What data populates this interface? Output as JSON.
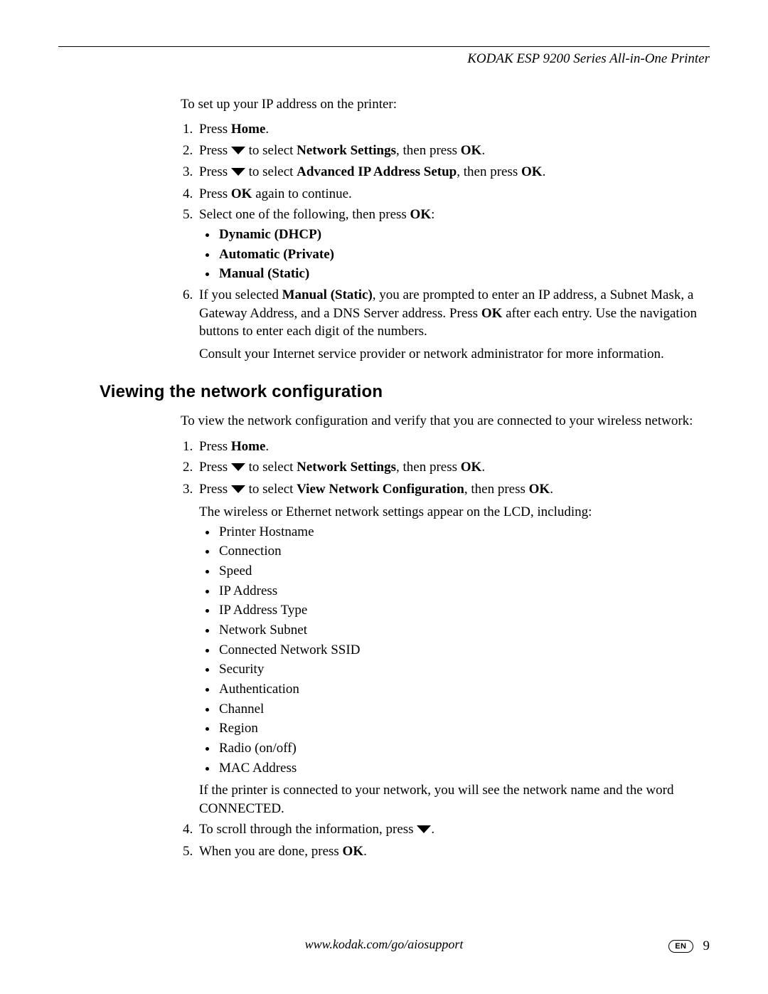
{
  "header": {
    "doc_title": "KODAK ESP 9200 Series All-in-One Printer"
  },
  "section1": {
    "intro": "To set up your IP address on the printer:",
    "steps": {
      "s1_pre": "Press ",
      "s1_b1": "Home",
      "s1_post": ".",
      "s2_pre": "Press ",
      "s2_mid": " to select ",
      "s2_b1": "Network Settings",
      "s2_mid2": ", then press ",
      "s2_b2": "OK",
      "s2_post": ".",
      "s3_pre": "Press ",
      "s3_mid": " to select ",
      "s3_b1": "Advanced IP Address Setup",
      "s3_mid2": ", then press ",
      "s3_b2": "OK",
      "s3_post": ".",
      "s4_pre": "Press ",
      "s4_b1": "OK",
      "s4_post": " again to continue.",
      "s5_pre": "Select one of the following, then press ",
      "s5_b1": "OK",
      "s5_post": ":",
      "s5_opts": [
        "Dynamic (DHCP)",
        "Automatic (Private)",
        "Manual (Static)"
      ],
      "s6_pre": "If you selected ",
      "s6_b1": "Manual (Static)",
      "s6_mid": ", you are prompted to enter an IP address, a Subnet Mask, a Gateway Address, and a DNS Server address. Press ",
      "s6_b2": "OK",
      "s6_post": " after each entry. Use the navigation buttons to enter each digit of the numbers.",
      "s6_sub": "Consult your Internet service provider or network administrator for more information."
    }
  },
  "section2": {
    "heading": "Viewing the network configuration",
    "intro": "To view the network configuration and verify that you are connected to your wireless network:",
    "steps": {
      "s1_pre": "Press ",
      "s1_b1": "Home",
      "s1_post": ".",
      "s2_pre": "Press ",
      "s2_mid": " to select ",
      "s2_b1": "Network Settings",
      "s2_mid2": ", then press ",
      "s2_b2": "OK",
      "s2_post": ".",
      "s3_pre": "Press ",
      "s3_mid": " to select ",
      "s3_b1": "View Network Configuration",
      "s3_mid2": ", then press ",
      "s3_b2": "OK",
      "s3_post": ".",
      "s3_sub": "The wireless or Ethernet network settings appear on the LCD, including:",
      "s3_items": [
        "Printer Hostname",
        "Connection",
        "Speed",
        "IP Address",
        "IP Address Type",
        "Network Subnet",
        "Connected Network SSID",
        "Security",
        "Authentication",
        "Channel",
        "Region",
        "Radio (on/off)",
        "MAC Address"
      ],
      "s3_tail": "If the printer is connected to your network, you will see the network name and the word CONNECTED.",
      "s4_pre": "To scroll through the information, press ",
      "s4_post": ".",
      "s5_pre": "When you are done, press ",
      "s5_b1": "OK",
      "s5_post": "."
    }
  },
  "footer": {
    "url": "www.kodak.com/go/aiosupport",
    "lang": "EN",
    "page": "9"
  }
}
